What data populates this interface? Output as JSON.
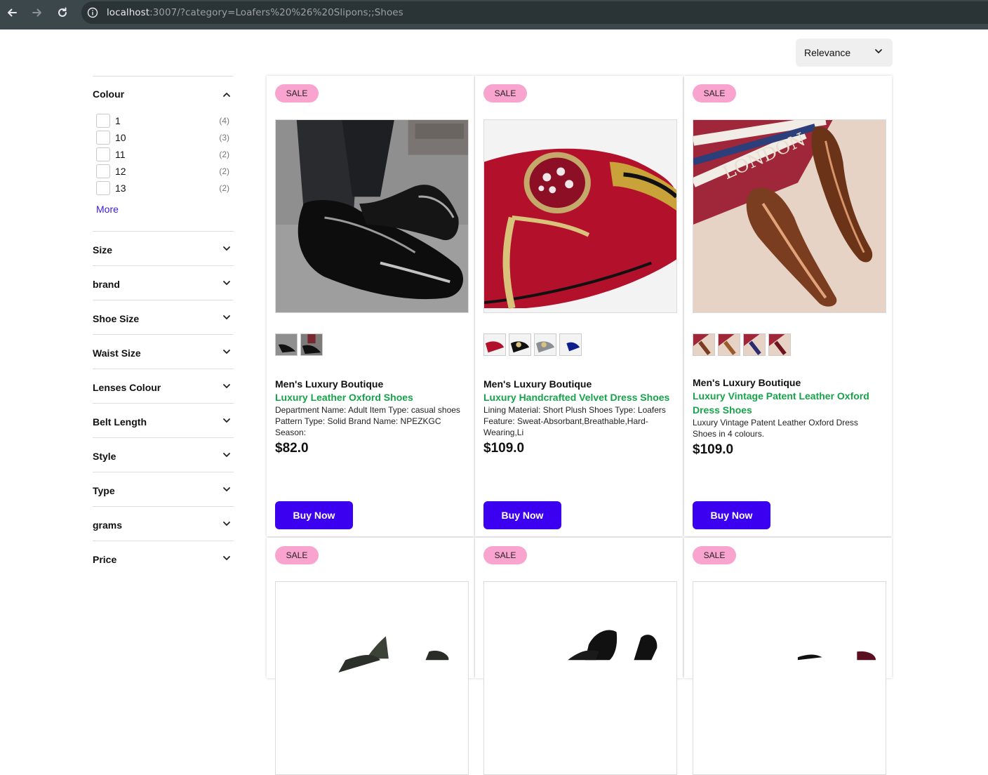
{
  "browser": {
    "url_host": "localhost",
    "url_rest": ":3007/?category=Loafers%20%26%20Slipons;;Shoes"
  },
  "sort": {
    "selected": "Relevance"
  },
  "filters": {
    "colour": {
      "title": "Colour",
      "options": [
        {
          "label": "1",
          "count": "(4)"
        },
        {
          "label": "10",
          "count": "(3)"
        },
        {
          "label": "11",
          "count": "(2)"
        },
        {
          "label": "12",
          "count": "(2)"
        },
        {
          "label": "13",
          "count": "(2)"
        }
      ],
      "more_label": "More"
    },
    "collapsed": [
      "Size",
      "brand",
      "Shoe Size",
      "Waist Size",
      "Lenses Colour",
      "Belt Length",
      "Style",
      "Type",
      "grams",
      "Price"
    ]
  },
  "products": [
    {
      "badge": "SALE",
      "brand": "Men's Luxury Boutique",
      "name": "Luxury Leather Oxford Shoes",
      "description": "Department Name: Adult Item Type: casual shoes Pattern Type: Solid Brand Name: NPEZKGC Season:",
      "price": "$82.0",
      "buy_label": "Buy Now"
    },
    {
      "badge": "SALE",
      "brand": "Men's Luxury Boutique",
      "name": "Luxury Handcrafted Velvet Dress Shoes",
      "description": "Lining Material: Short Plush Shoes Type: Loafers Feature: Sweat-Absorbant,Breathable,Hard-Wearing,Li",
      "price": "$109.0",
      "buy_label": "Buy Now"
    },
    {
      "badge": "SALE",
      "brand": "Men's Luxury Boutique",
      "name": "Luxury Vintage Patent Leather Oxford Dress Shoes",
      "description": "Luxury Vintage Patent Leather Oxford Dress Shoes in 4 colours.",
      "price": "$109.0",
      "buy_label": "Buy Now"
    },
    {
      "badge": "SALE"
    },
    {
      "badge": "SALE"
    },
    {
      "badge": "SALE"
    }
  ],
  "colors": {
    "accent": "#3b00f0",
    "product_name": "#16a34a",
    "sale_badge": "#f9a3cf",
    "more_link": "#3a1bd9"
  }
}
